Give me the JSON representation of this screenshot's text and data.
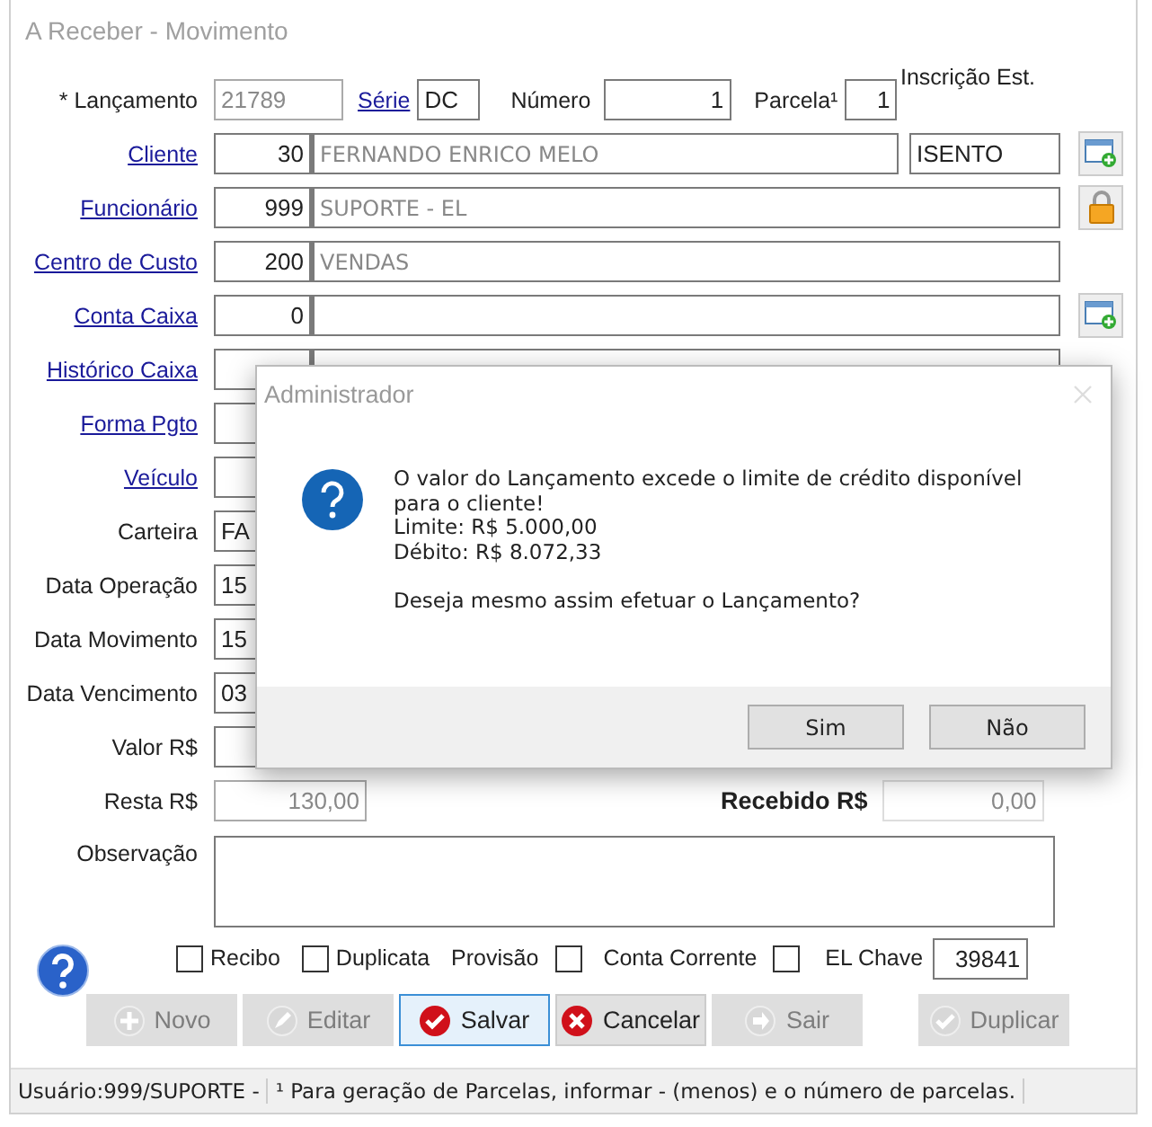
{
  "window": {
    "title": "A Receber - Movimento"
  },
  "header": {
    "lancamento": {
      "label": "* Lançamento",
      "value": "21789",
      "disabled": true
    },
    "serie": {
      "label": "Série",
      "value": "DC"
    },
    "numero": {
      "label": "Número",
      "value": "1"
    },
    "parcela": {
      "label": "Parcela¹",
      "value": "1"
    },
    "inscricao_label": "Inscrição Est."
  },
  "rows": [
    {
      "kind": "lookup",
      "label": "Cliente",
      "code": "30",
      "name": "FERNANDO ENRICO MELO",
      "extra": "ISENTO"
    },
    {
      "kind": "lookup",
      "label": "Funcionário",
      "code": "999",
      "name": "SUPORTE - EL"
    },
    {
      "kind": "lookup",
      "label": "Centro de Custo",
      "code": "200",
      "name": "VENDAS"
    },
    {
      "kind": "lookup",
      "label": "Conta Caixa",
      "code": "0"
    },
    {
      "kind": "lookup",
      "label": "Histórico Caixa"
    },
    {
      "kind": "link-field",
      "label": "Forma Pgto"
    },
    {
      "kind": "link-field",
      "label": "Veículo"
    },
    {
      "kind": "field",
      "label": "Carteira",
      "value": "FA"
    },
    {
      "kind": "field",
      "label": "Data Operação",
      "value": "15"
    },
    {
      "kind": "field",
      "label": "Data Movimento",
      "value": "15"
    },
    {
      "kind": "field",
      "label": "Data Vencimento",
      "value": "03"
    },
    {
      "kind": "field",
      "label": "Valor R$"
    }
  ],
  "totals": {
    "resta": {
      "label": "Resta R$",
      "value": "130,00"
    },
    "recebido": {
      "label": "Recebido R$",
      "value": "0,00"
    }
  },
  "observacao": {
    "label": "Observação"
  },
  "options": [
    {
      "kind": "box-left",
      "label": "Recibo",
      "checked": false
    },
    {
      "kind": "box-left",
      "label": "Duplicata",
      "checked": false
    },
    {
      "kind": "box-right",
      "label": "Provisão",
      "checked": false
    },
    {
      "kind": "box-right",
      "label": "Conta Corrente",
      "checked": false
    }
  ],
  "chave": {
    "label": "EL Chave",
    "value": "39841"
  },
  "buttons": [
    {
      "label": "Novo",
      "kind": "new",
      "disabled": true,
      "focused": false
    },
    {
      "label": "Editar",
      "kind": "edit",
      "disabled": true,
      "focused": false
    },
    {
      "label": "Salvar",
      "kind": "save",
      "disabled": false,
      "focused": true
    },
    {
      "label": "Cancelar",
      "kind": "cancel",
      "disabled": false,
      "focused": false
    },
    {
      "label": "Sair",
      "kind": "exit",
      "disabled": true,
      "focused": false
    },
    {
      "label": "Duplicar",
      "kind": "duplicate",
      "disabled": true,
      "focused": false
    }
  ],
  "status_bar": [
    "Usuário:999/SUPORTE -",
    "¹ Para geração de Parcelas, informar - (menos) e o número de parcelas."
  ],
  "dialog": {
    "title": "Administrador",
    "paragraphs": [
      [
        "O valor do Lançamento excede o limite de crédito disponível para o cliente!",
        "Limite: R$ 5.000,00",
        "Débito: R$ 8.072,33"
      ],
      [
        "Deseja mesmo assim efetuar o Lançamento?"
      ]
    ],
    "buttons": [
      "Sim",
      "Não"
    ]
  }
}
